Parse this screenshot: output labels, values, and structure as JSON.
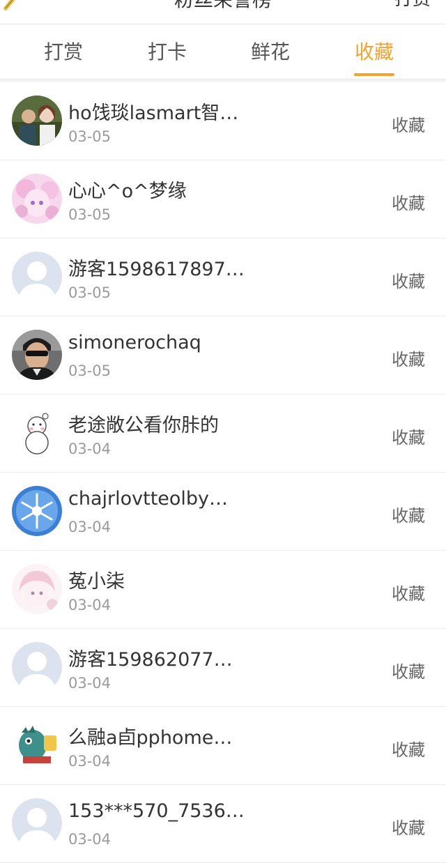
{
  "header": {
    "title": "粉丝荣誉榜",
    "right_action": "打赏"
  },
  "tabs": [
    {
      "label": "打赏",
      "active": false
    },
    {
      "label": "打卡",
      "active": false
    },
    {
      "label": "鲜花",
      "active": false
    },
    {
      "label": "收藏",
      "active": true
    }
  ],
  "colors": {
    "accent": "#f2a22e",
    "text_primary": "#333333",
    "text_secondary": "#9a9a9a",
    "divider": "#ececec"
  },
  "list": [
    {
      "name": "ho饯琰lasmart智…",
      "date": "03-05",
      "type": "收藏",
      "avatar": "photo-avatar"
    },
    {
      "name": "心心^o^梦缘",
      "date": "03-05",
      "type": "收藏",
      "avatar": "anime-pink-avatar"
    },
    {
      "name": "游客1598617897…",
      "date": "03-05",
      "type": "收藏",
      "avatar": "default-avatar"
    },
    {
      "name": "simonerochaq",
      "date": "03-05",
      "type": "收藏",
      "avatar": "sunglasses-photo-avatar"
    },
    {
      "name": "老途敞公看你胩的",
      "date": "03-04",
      "type": "收藏",
      "avatar": "snowman-sketch-avatar"
    },
    {
      "name": "chajrlovtteolby…",
      "date": "03-04",
      "type": "收藏",
      "avatar": "snowflake-avatar"
    },
    {
      "name": "菟小柒",
      "date": "03-04",
      "type": "收藏",
      "avatar": "anime-light-avatar"
    },
    {
      "name": "游客159862077…",
      "date": "03-04",
      "type": "收藏",
      "avatar": "default-avatar"
    },
    {
      "name": "么融a卣pphome…",
      "date": "03-04",
      "type": "收藏",
      "avatar": "cartoon-monster-avatar"
    },
    {
      "name": "153***570_7536…",
      "date": "03-04",
      "type": "收藏",
      "avatar": "default-avatar"
    }
  ]
}
